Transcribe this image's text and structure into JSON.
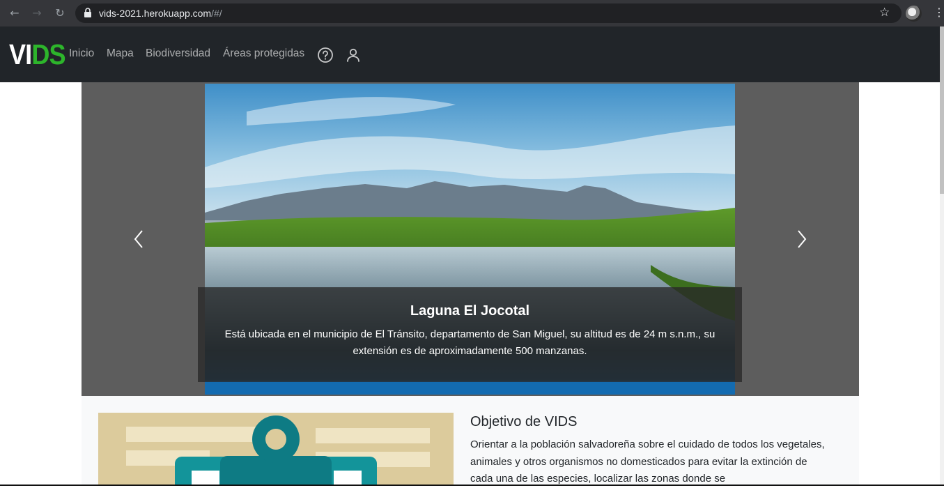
{
  "browser": {
    "url_host": "vids-2021.herokuapp.com",
    "url_path": "/#/"
  },
  "navbar": {
    "logo_part1": "VI",
    "logo_part2": "DS",
    "links": [
      "Inicio",
      "Mapa",
      "Biodiversidad",
      "Áreas protegidas"
    ],
    "help_icon": "question-circle-icon",
    "user_icon": "person-icon"
  },
  "carousel": {
    "slide": {
      "title": "Laguna El Jocotal",
      "description": "Está ubicada en el municipio de El Tránsito, departamento de San Miguel, su altitud es de 24 m s.n.m., su extensión es de aproximadamente 500 manzanas."
    },
    "prev_icon": "chevron-left-icon",
    "next_icon": "chevron-right-icon"
  },
  "objective": {
    "title": "Objetivo de VIDS",
    "text": "Orientar a la población salvadoreña sobre el cuidado de todos los vegetales, animales y otros organismos no domesticados para evitar la extinción de cada una de las especies, localizar las zonas donde se"
  },
  "colors": {
    "navbar_bg": "#212529",
    "logo_green": "#2db52b",
    "carousel_bg": "#5d5d5d",
    "content_bg": "#f8f9fa"
  }
}
